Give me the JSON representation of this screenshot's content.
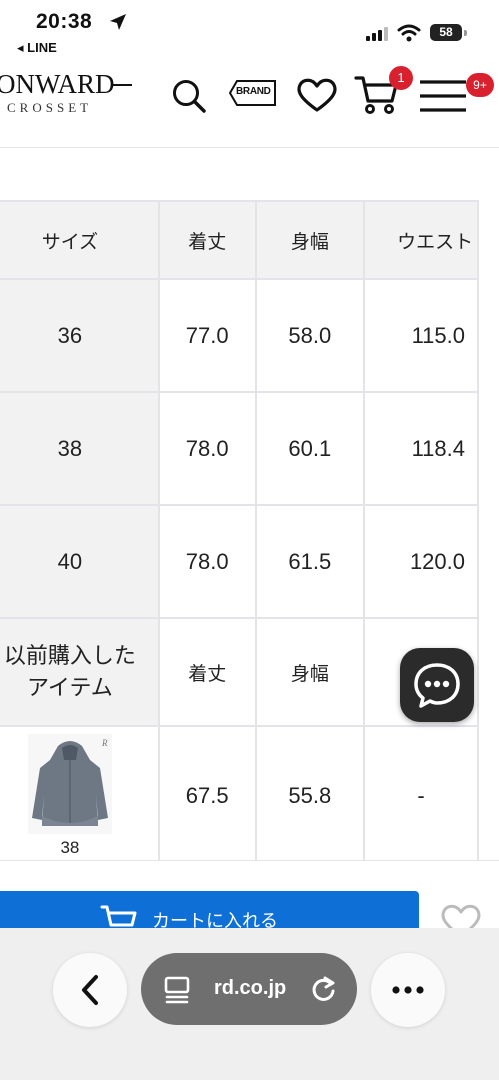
{
  "status_bar": {
    "time": "20:38",
    "back_app": "◂ LINE",
    "battery": "58"
  },
  "header": {
    "logo_main": "ONWARD",
    "logo_sub": "CROSSET",
    "brand_label": "BRAND",
    "cart_badge": "1",
    "menu_badge": "9+"
  },
  "size_table": {
    "headers": [
      "サイズ",
      "着丈",
      "身幅",
      "ウエスト"
    ],
    "rows": [
      [
        "36",
        "77.0",
        "58.0",
        "115.0"
      ],
      [
        "38",
        "78.0",
        "60.1",
        "118.4"
      ],
      [
        "40",
        "78.0",
        "61.5",
        "120.0"
      ]
    ],
    "previous_purchase": {
      "label_line1": "以前購入した",
      "label_line2": "アイテム",
      "headers": [
        "着丈",
        "身幅",
        ""
      ],
      "item_size": "38",
      "values": [
        "67.5",
        "55.8",
        "-"
      ]
    }
  },
  "cart_button": {
    "label": "カートに入れる"
  },
  "browser": {
    "url": "rd.co.jp"
  },
  "colors": {
    "accent_blue": "#0e6fd6",
    "badge_red": "#d9202f"
  }
}
